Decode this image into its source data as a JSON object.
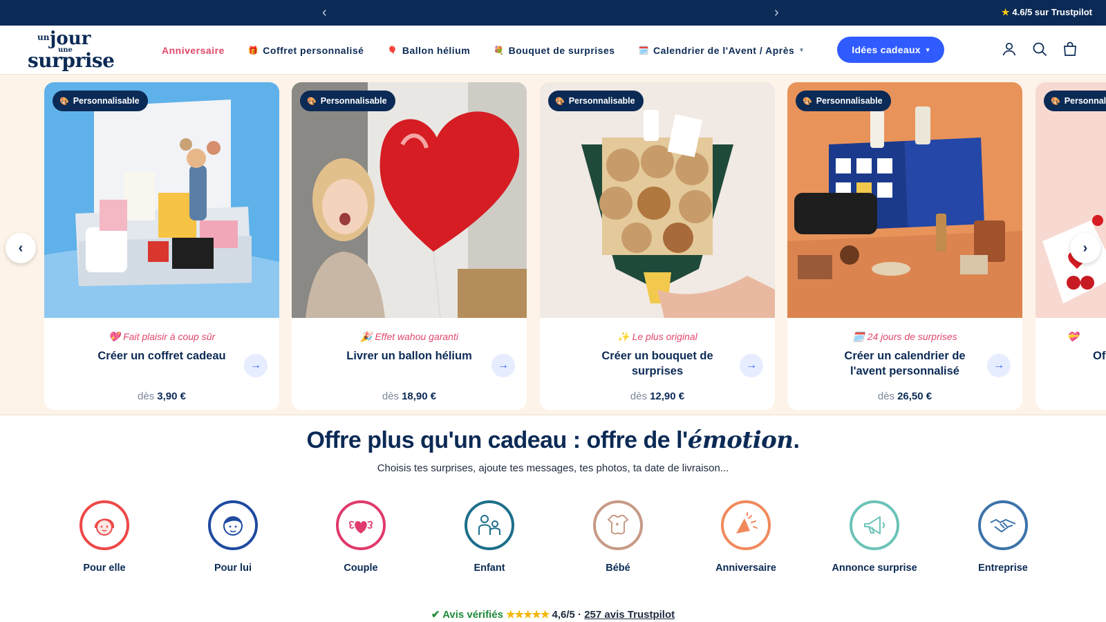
{
  "topbar": {
    "prev_arrow": "‹",
    "next_arrow": "›",
    "trustpilot": "4.6/5 sur Trustpilot"
  },
  "logo": {
    "l1": "un",
    "l2": "jour",
    "l3": "une",
    "l4": "surprise"
  },
  "nav": {
    "items": [
      {
        "label": "Anniversaire",
        "emoji": ""
      },
      {
        "label": "Coffret personnalisé",
        "emoji": "🎁"
      },
      {
        "label": "Ballon hélium",
        "emoji": "🎈"
      },
      {
        "label": "Bouquet de surprises",
        "emoji": "💐"
      },
      {
        "label": "Calendrier de l'Avent / Après",
        "emoji": "🗓️"
      }
    ],
    "cta": "Idées cadeaux"
  },
  "icons": {
    "account": "user-icon",
    "search": "search-icon",
    "cart": "bag-icon"
  },
  "carousel": {
    "badge": "Personnalisable",
    "cards": [
      {
        "tag": "💖 Fait plaisir à coup sûr",
        "title": "Créer un coffret cadeau",
        "from": "dès",
        "price": "3,90 €"
      },
      {
        "tag": "🎉 Effet wahou garanti",
        "title": "Livrer un ballon hélium",
        "from": "dès",
        "price": "18,90 €"
      },
      {
        "tag": "✨ Le plus original",
        "title": "Créer un bouquet de surprises",
        "from": "dès",
        "price": "12,90 €"
      },
      {
        "tag": "🗓️ 24 jours de surprises",
        "title": "Créer un calendrier de l'avent personnalisé",
        "from": "dès",
        "price": "26,50 €"
      },
      {
        "tag": "💝",
        "title": "Of",
        "from": "",
        "price": ""
      }
    ],
    "prev": "‹",
    "next": "›"
  },
  "emotion": {
    "headline_a": "Offre plus qu'un cadeau : offre de l'",
    "headline_em": "émotion",
    "headline_end": ".",
    "sub": "Choisis tes surprises, ajoute tes messages, tes photos, ta date de livraison..."
  },
  "categories": [
    {
      "label": "Pour elle",
      "color": "#ee4848"
    },
    {
      "label": "Pour lui",
      "color": "#1e4aa0"
    },
    {
      "label": "Couple",
      "color": "#e03a6c"
    },
    {
      "label": "Enfant",
      "color": "#1d6f8a"
    },
    {
      "label": "Bébé",
      "color": "#c79a86"
    },
    {
      "label": "Anniversaire",
      "color": "#f08a5d"
    },
    {
      "label": "Annonce surprise",
      "color": "#6cc3b8"
    },
    {
      "label": "Entreprise",
      "color": "#3b73a9"
    }
  ],
  "reviews": {
    "check": "Avis vérifiés",
    "stars": "★★★★★",
    "score": "4,6/5 ·",
    "link": "257 avis Trustpilot"
  }
}
